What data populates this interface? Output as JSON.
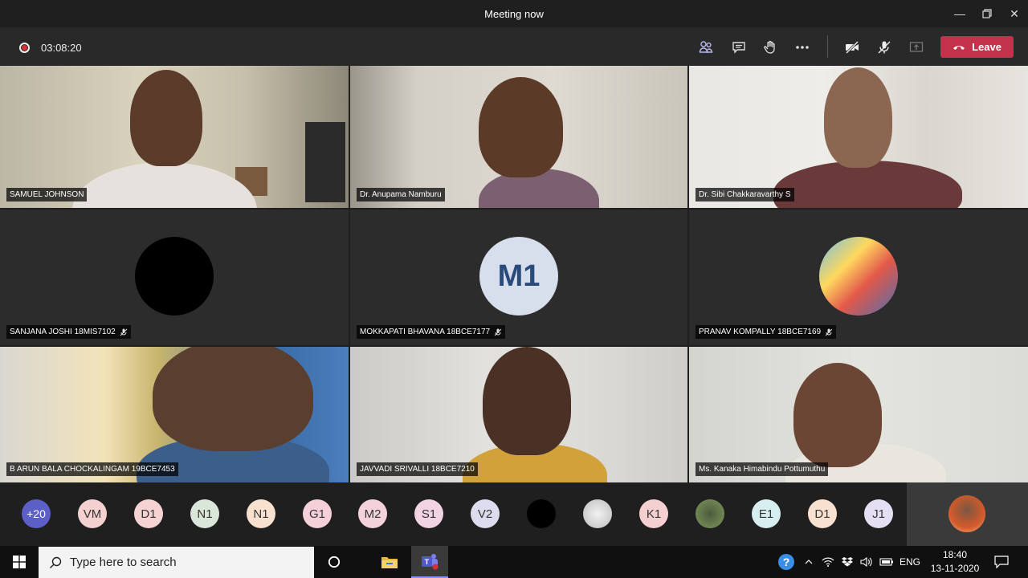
{
  "window": {
    "title": "Meeting now"
  },
  "toolbar": {
    "timer": "03:08:20",
    "leave_label": "Leave"
  },
  "tiles": [
    {
      "name": "SAMUEL JOHNSON"
    },
    {
      "name": "Dr. Anupama Namburu"
    },
    {
      "name": "Dr. Sibi Chakkaravarthy S"
    },
    {
      "name": "SANJANA JOSHI 18MIS7102"
    },
    {
      "name": "MOKKAPATI BHAVANA 18BCE7177",
      "initials": "M1"
    },
    {
      "name": "PRANAV KOMPALLY 18BCE7169"
    },
    {
      "name": "B ARUN BALA CHOCKALINGAM 19BCE7453"
    },
    {
      "name": "JAVVADI SRIVALLI 18BCE7210"
    },
    {
      "name": "Ms. Kanaka Himabindu Pottumuthu"
    }
  ],
  "participants": [
    "+20",
    "VM",
    "D1",
    "N1",
    "N1",
    "G1",
    "M2",
    "S1",
    "V2",
    "",
    "",
    "K1",
    "",
    "E1",
    "D1",
    "J1"
  ],
  "taskbar": {
    "search_placeholder": "Type here to search",
    "lang": "ENG",
    "time": "18:40",
    "date": "13-11-2020"
  },
  "colors": {
    "leave": "#c4314b",
    "accent_teams": "#5b5fc7",
    "record": "#d13438"
  }
}
